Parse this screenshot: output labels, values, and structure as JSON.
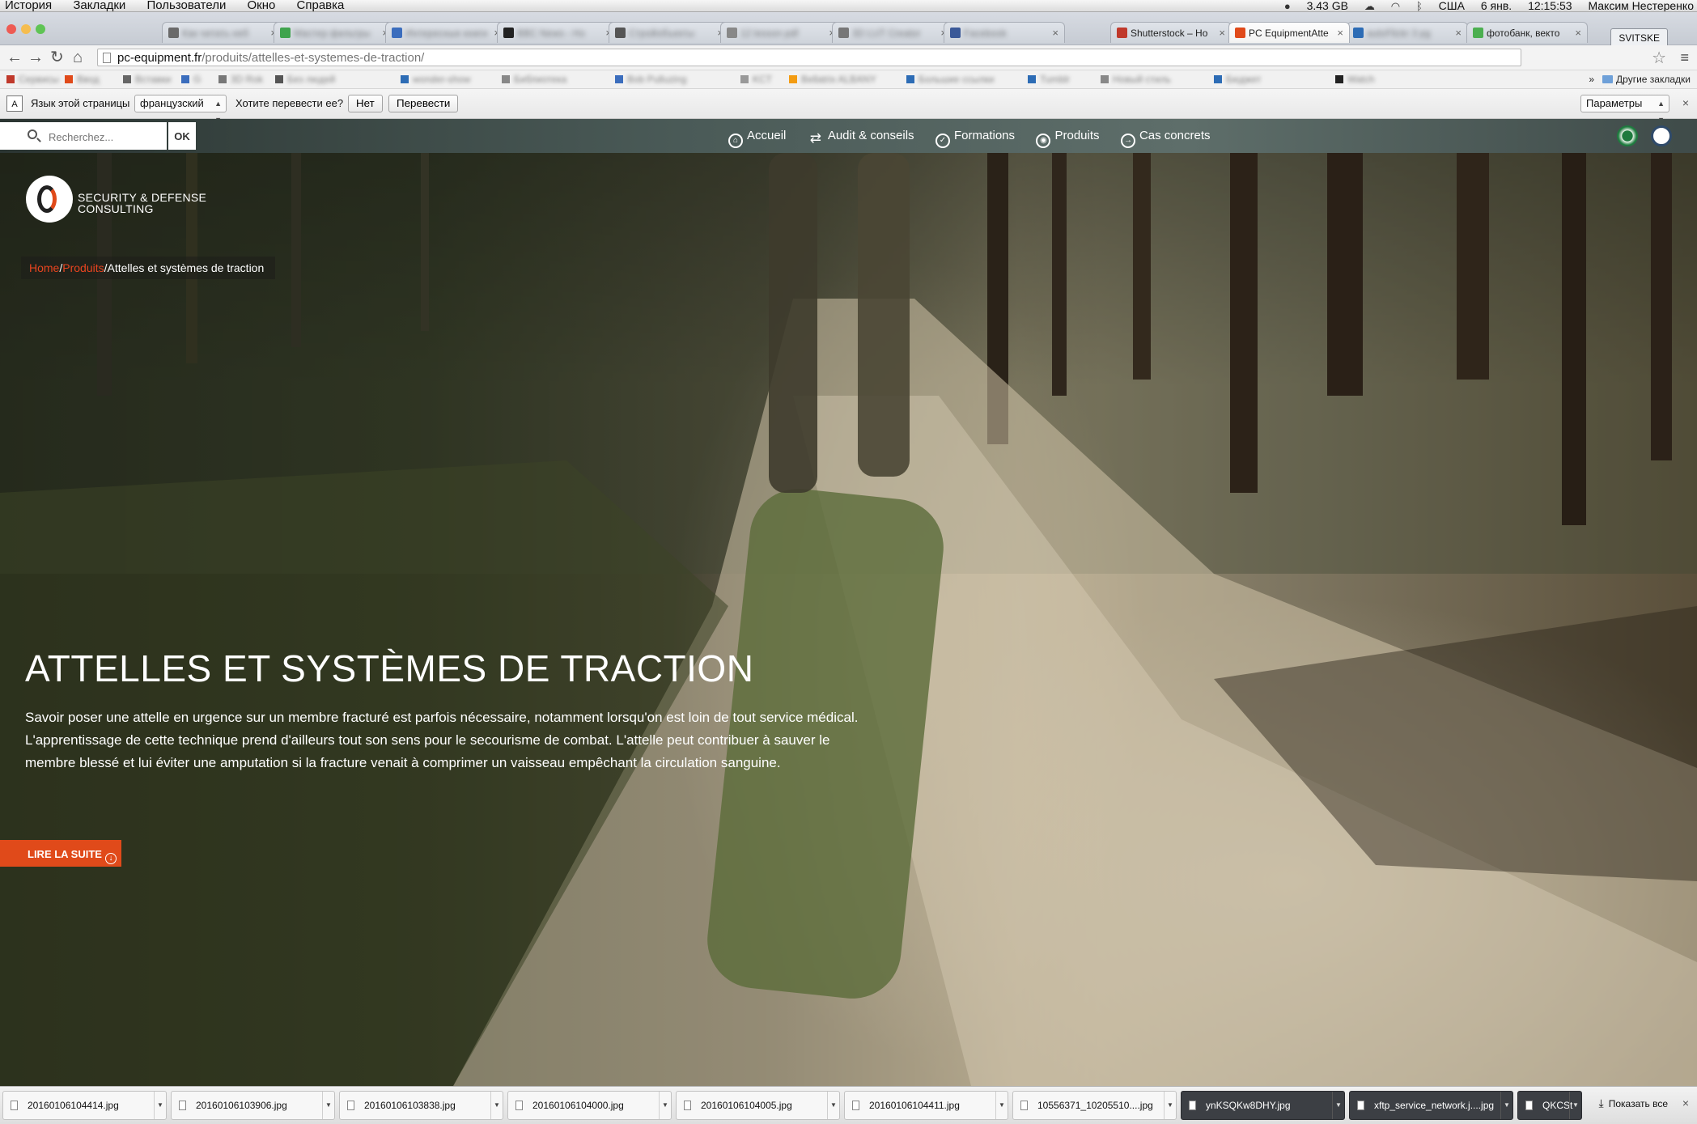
{
  "menubar": {
    "items": [
      "История",
      "Закладки",
      "Пользователи",
      "Окно",
      "Справка"
    ],
    "status": {
      "memory": "3.43 GB",
      "keyboard": "США",
      "date": "6 янв.",
      "time": "12:15:53",
      "user": "Максим Нестеренко"
    }
  },
  "tabs": [
    {
      "label": "Как читать неб",
      "blurred": true,
      "favicon": "#6a6a6a"
    },
    {
      "label": "Мастер фильтры",
      "blurred": true,
      "favicon": "#3fa34d"
    },
    {
      "label": "Интересные книги",
      "blurred": true,
      "favicon": "#3b6dbd"
    },
    {
      "label": "BBC News - Ho",
      "blurred": true,
      "favicon": "#222222"
    },
    {
      "label": "Стройобъекты",
      "blurred": true,
      "favicon": "#555555"
    },
    {
      "label": "12 lesson pdf",
      "blurred": true,
      "favicon": "#888888"
    },
    {
      "label": "3D LUT Creator",
      "blurred": true,
      "favicon": "#777777"
    },
    {
      "label": "Facebook",
      "blurred": true,
      "favicon": "#3b5998"
    },
    {
      "label": "Shutterstock – Ho",
      "blurred": false,
      "favicon": "#c0392b"
    },
    {
      "label": "PC EquipmentAtte",
      "blurred": false,
      "active": true,
      "favicon": "#e04a1a"
    },
    {
      "label": "autoFlickr 3 pg",
      "blurred": true,
      "favicon": "#2d6cb5"
    },
    {
      "label": "фотобанк, векто",
      "blurred": false,
      "favicon": "#4caf50"
    }
  ],
  "profile": "SVITSKE",
  "omnibox": {
    "host": "pc-equipment.fr",
    "path": "/produits/attelles-et-systemes-de-traction/"
  },
  "bookmarks": {
    "items": [
      "Сервисы",
      "Ввод",
      "Вставки",
      "G",
      "3D Rok",
      "Без людей",
      "wonder-show",
      "Библиотека",
      "Bob Pulluzing",
      "KCT",
      "Bellatrix ALBANY",
      "Большие ссылки",
      "Tumblr",
      "Новый стиль",
      "Бюджет",
      "Watch"
    ],
    "other": "Другие закладки"
  },
  "translate": {
    "label": "Язык этой страницы",
    "language": "французский",
    "question": "Хотите перевести ее?",
    "no": "Нет",
    "yes": "Перевести",
    "options": "Параметры"
  },
  "site": {
    "search": {
      "placeholder": "Recherchez...",
      "button": "OK"
    },
    "nav": [
      "Accueil",
      "Audit & conseils",
      "Formations",
      "Produits",
      "Cas concrets"
    ],
    "logo": {
      "line1": "SECURITY & DEFENSE",
      "line2": "CONSULTING"
    },
    "breadcrumb": {
      "home": "Home",
      "produits": "Produits",
      "current": "Attelles et systèmes de traction",
      "sep": "/"
    },
    "hero": {
      "title": "ATTELLES ET SYSTÈMES DE TRACTION",
      "text": "Savoir poser une attelle en urgence sur un membre fracturé est parfois nécessaire, notamment lorsqu'on est loin de tout service médical. L'apprentissage de cette technique prend d'ailleurs tout son sens pour le secourisme de combat. L'attelle peut contribuer à sauver le membre blessé et lui éviter une amputation si la fracture venait à comprimer un vaisseau empêchant la circulation sanguine.",
      "cta": "LIRE LA SUITE"
    },
    "accent": "#e04a1a"
  },
  "downloads": {
    "files": [
      {
        "name": "20160106104414.jpg",
        "dark": false
      },
      {
        "name": "20160106103906.jpg",
        "dark": false
      },
      {
        "name": "20160106103838.jpg",
        "dark": false
      },
      {
        "name": "20160106104000.jpg",
        "dark": false
      },
      {
        "name": "20160106104005.jpg",
        "dark": false
      },
      {
        "name": "20160106104411.jpg",
        "dark": false
      },
      {
        "name": "10556371_10205510....jpg",
        "dark": false
      },
      {
        "name": "ynKSQKw8DHY.jpg",
        "dark": true
      },
      {
        "name": "xftp_service_network.j....jpg",
        "dark": true
      },
      {
        "name": "QKCSt",
        "dark": true
      }
    ],
    "show_all": "Показать все"
  }
}
